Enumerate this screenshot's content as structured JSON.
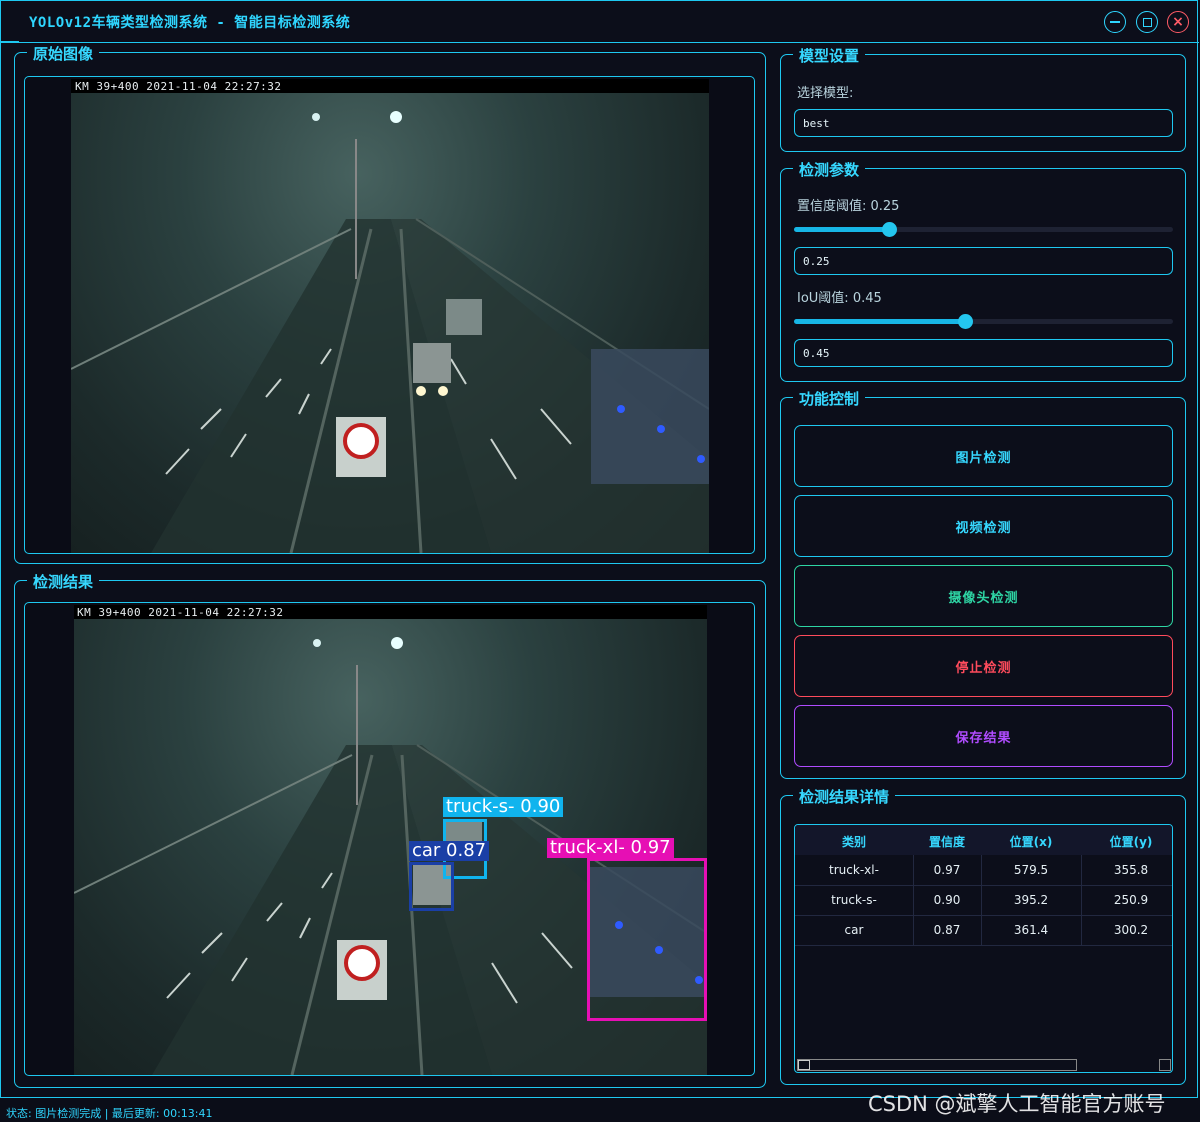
{
  "window": {
    "title": "YOLOv12车辆类型检测系统 - 智能目标检测系统"
  },
  "colors": {
    "accent": "#1ec8f0",
    "title": "#2fd6ff",
    "close": "#ff5b66",
    "btn_image": "#1ec8f0",
    "btn_video": "#1ec8f0",
    "btn_camera": "#2ed5a4",
    "btn_stop": "#ff4b5c",
    "btn_save": "#b04cff",
    "truck_xl": "#e60fb4",
    "truck_s": "#10b4ee",
    "car": "#1a3fa6"
  },
  "panels": {
    "original": {
      "title": "原始图像",
      "timestamp": "KM 39+400  2021-11-04  22:27:32"
    },
    "result": {
      "title": "检测结果",
      "timestamp": "KM 39+400  2021-11-04  22:27:32"
    }
  },
  "detections": [
    {
      "label": "truck-xl- 0.97",
      "cls": "truck-xl-",
      "conf": 0.97
    },
    {
      "label": "truck-s- 0.90",
      "cls": "truck-s-",
      "conf": 0.9
    },
    {
      "label": "car 0.87",
      "cls": "car",
      "conf": 0.87
    }
  ],
  "model": {
    "title": "模型设置",
    "select_label": "选择模型:",
    "value": "best"
  },
  "params": {
    "title": "检测参数",
    "conf_label": "置信度阈值: 0.25",
    "conf_value": "0.25",
    "conf": 0.25,
    "iou_label": "IoU阈值: 0.45",
    "iou_value": "0.45",
    "iou": 0.45
  },
  "controls": {
    "title": "功能控制",
    "image": "图片检测",
    "video": "视频检测",
    "camera": "摄像头检测",
    "stop": "停止检测",
    "save": "保存结果"
  },
  "details": {
    "title": "检测结果详情",
    "headers": [
      "类别",
      "置信度",
      "位置(x)",
      "位置(y)"
    ],
    "rows": [
      [
        "truck-xl-",
        "0.97",
        "579.5",
        "355.8"
      ],
      [
        "truck-s-",
        "0.90",
        "395.2",
        "250.9"
      ],
      [
        "car",
        "0.87",
        "361.4",
        "300.2"
      ]
    ]
  },
  "status": "状态: 图片检测完成 | 最后更新: 00:13:41",
  "watermark": "CSDN @斌擎人工智能官方账号"
}
